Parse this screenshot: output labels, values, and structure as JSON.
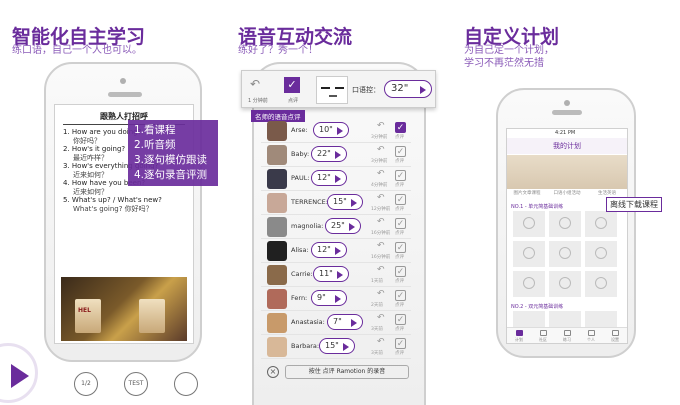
{
  "panel1": {
    "title": "智能化自主学习",
    "subtitle": "练口语，自己一个人也可以。",
    "doc_title": "跟熟人打招呼",
    "lines": [
      {
        "en": "1. How are you doing?",
        "cn": "你好吗？"
      },
      {
        "en": "2. How's it going?",
        "cn": "最近咋样？"
      },
      {
        "en": "3. How's everything going?",
        "cn": "近来如何？"
      },
      {
        "en": "4. How have you been?",
        "cn": "近来如何？"
      },
      {
        "en": "5. What's up? / What's new?",
        "cn": "What's going? 你好吗？"
      }
    ],
    "features": [
      "1.看课程",
      "2.听音频",
      "3.逐句模仿跟读",
      "4.逐句录音评测"
    ],
    "cup_text": "HEL"
  },
  "panel2": {
    "title": "语音互动交流",
    "subtitle": "练好了？秀一个！",
    "toolbar": {
      "undo_label": "1 分钟前",
      "check_label": "点评",
      "speed_label": "口语控：",
      "speed_value": "32\""
    },
    "roster_label": "名师的语音点评",
    "rows": [
      {
        "name": "Arse:",
        "duration": "10\"",
        "count": "3分钟前",
        "checked": true,
        "color": "#7a5a4a"
      },
      {
        "name": "Baby:",
        "duration": "22\"",
        "count": "3分钟前",
        "checked": false,
        "color": "#a08a7a"
      },
      {
        "name": "PAUL:",
        "duration": "12\"",
        "count": "4分钟前",
        "checked": false,
        "color": "#3a3a4a"
      },
      {
        "name": "TERRENCE:",
        "duration": "15\"",
        "count": "12分钟前",
        "checked": false,
        "color": "#c8a898"
      },
      {
        "name": "magnolia:",
        "duration": "25\"",
        "count": "16分钟前",
        "checked": false,
        "color": "#8a8a8a"
      },
      {
        "name": "Alisa:",
        "duration": "12\"",
        "count": "16分钟前",
        "checked": false,
        "color": "#202020"
      },
      {
        "name": "Carrie:",
        "duration": "11\"",
        "count": "1天前",
        "checked": false,
        "color": "#8a6a4a"
      },
      {
        "name": "Fern:",
        "duration": "9\"",
        "count": "2天前",
        "checked": false,
        "color": "#b06a5a"
      },
      {
        "name": "Anastasia:",
        "duration": "7\"",
        "count": "3天前",
        "checked": false,
        "color": "#c89a6a"
      },
      {
        "name": "Barbara:",
        "duration": "15\"",
        "count": "3天前",
        "checked": false,
        "color": "#d8b898"
      }
    ],
    "check_caption": "点评",
    "bottom_button": "按住 点评 Ramotion 的录音"
  },
  "panel3": {
    "title": "自定义计划",
    "subtitle": "为自己定一个计划，\n学习不再茫然无措",
    "statusbar_time": "4:21 PM",
    "header": "我的计划",
    "banner_tabs": [
      "图片文章课程",
      "口语小组活动",
      "生活英语"
    ],
    "section1": "NO.1 - 单元简基础训练",
    "section2": "NO.2 - 双元简基础训练",
    "callout": "离线下载课程",
    "nav": [
      "计划",
      "社区",
      "练习",
      "个人",
      "设置"
    ]
  },
  "bottom_icons": [
    "1/2",
    "TEST",
    ""
  ]
}
